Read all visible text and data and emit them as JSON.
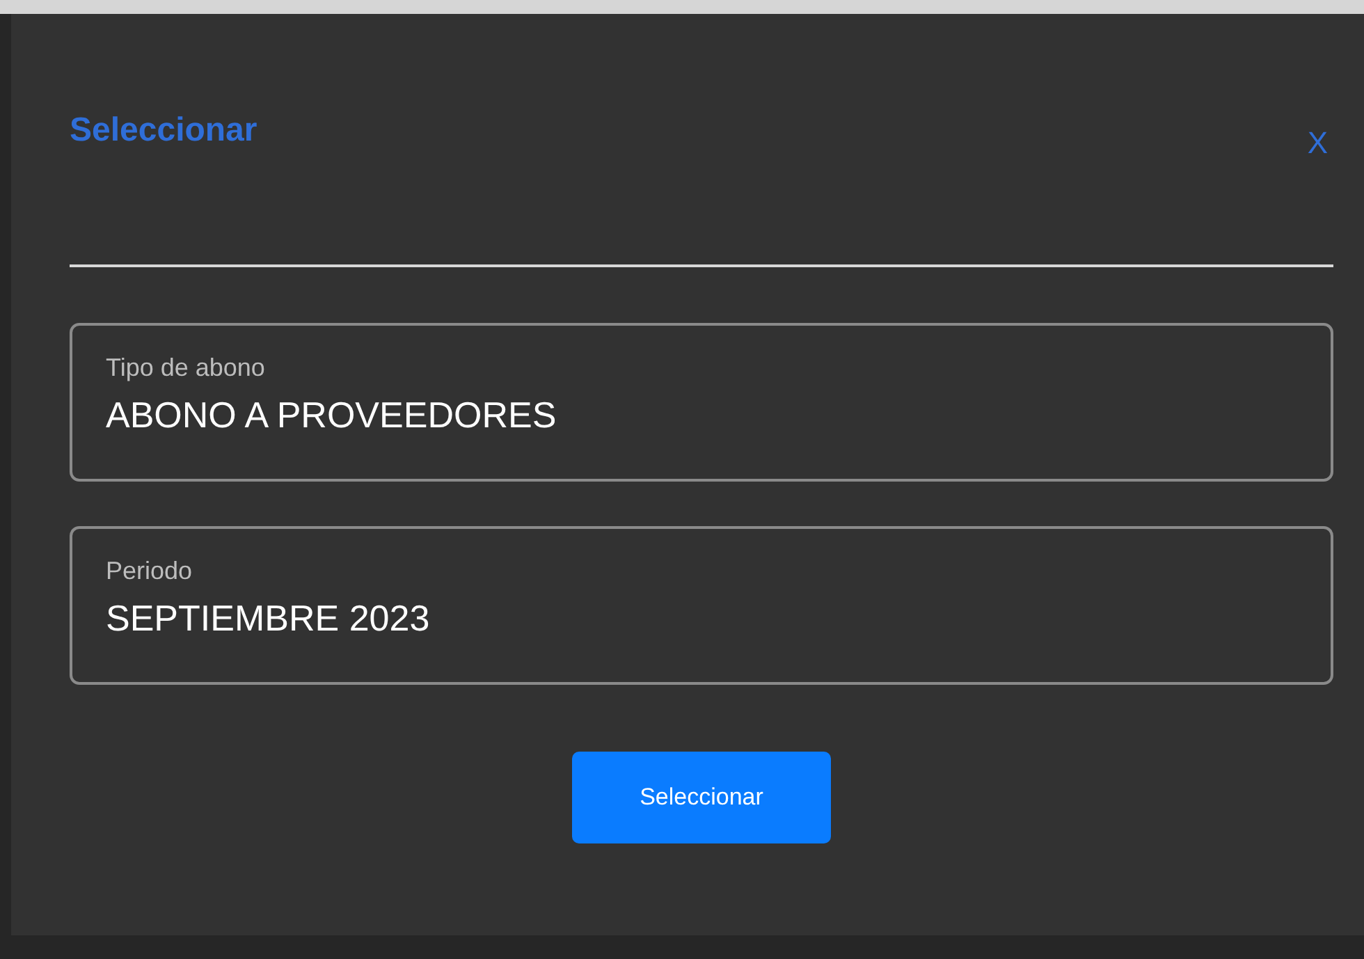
{
  "dialog": {
    "title": "Seleccionar",
    "close": "X"
  },
  "fields": [
    {
      "label": "Tipo de abono",
      "value": "ABONO A PROVEEDORES"
    },
    {
      "label": "Periodo",
      "value": "SEPTIEMBRE 2023"
    }
  ],
  "button": "Seleccionar"
}
